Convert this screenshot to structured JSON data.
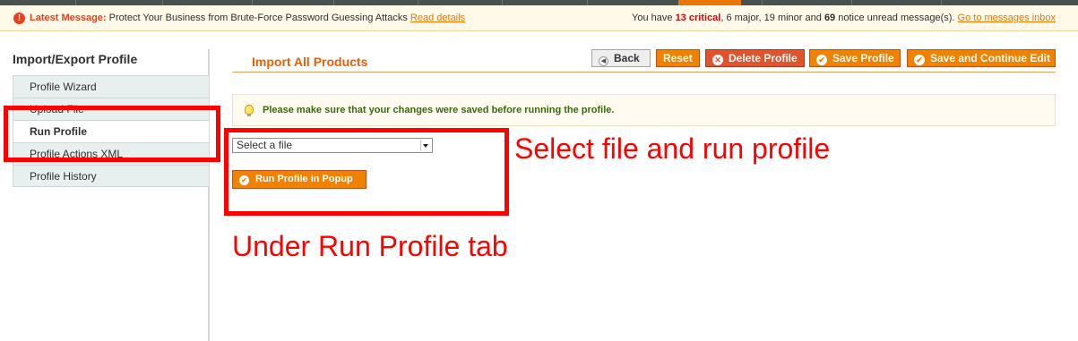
{
  "message_bar": {
    "label": "Latest Message:",
    "text": "Protect Your Business from Brute-Force Password Guessing Attacks",
    "link": "Read details",
    "summary_prefix": "You have",
    "critical": "13 critical",
    "major": "6 major",
    "minor": "19 minor",
    "notice_count": "69",
    "summary_suffix": "notice unread message(s).",
    "inbox_link": "Go to messages inbox"
  },
  "sidebar": {
    "title": "Import/Export Profile",
    "tabs": [
      {
        "label": "Profile Wizard",
        "active": false
      },
      {
        "label": "Upload File",
        "active": false
      },
      {
        "label": "Run Profile",
        "active": true
      },
      {
        "label": "Profile Actions XML",
        "active": false
      },
      {
        "label": "Profile History",
        "active": false
      }
    ]
  },
  "header": {
    "title": "Import All Products",
    "buttons": {
      "back": "Back",
      "reset": "Reset",
      "delete": "Delete Profile",
      "save": "Save Profile",
      "save_continue": "Save and Continue Edit"
    }
  },
  "notice": {
    "text": "Please make sure that your changes were saved before running the profile."
  },
  "form": {
    "select_value": "Select a file",
    "run_button": "Run Profile in Popup"
  },
  "annotations": {
    "right": "Select file and run profile",
    "bottom": "Under Run Profile tab",
    "color": "#ff0000"
  },
  "colors": {
    "accent": "#f18200",
    "title": "#eb5e00",
    "alert": "#e8401c"
  }
}
